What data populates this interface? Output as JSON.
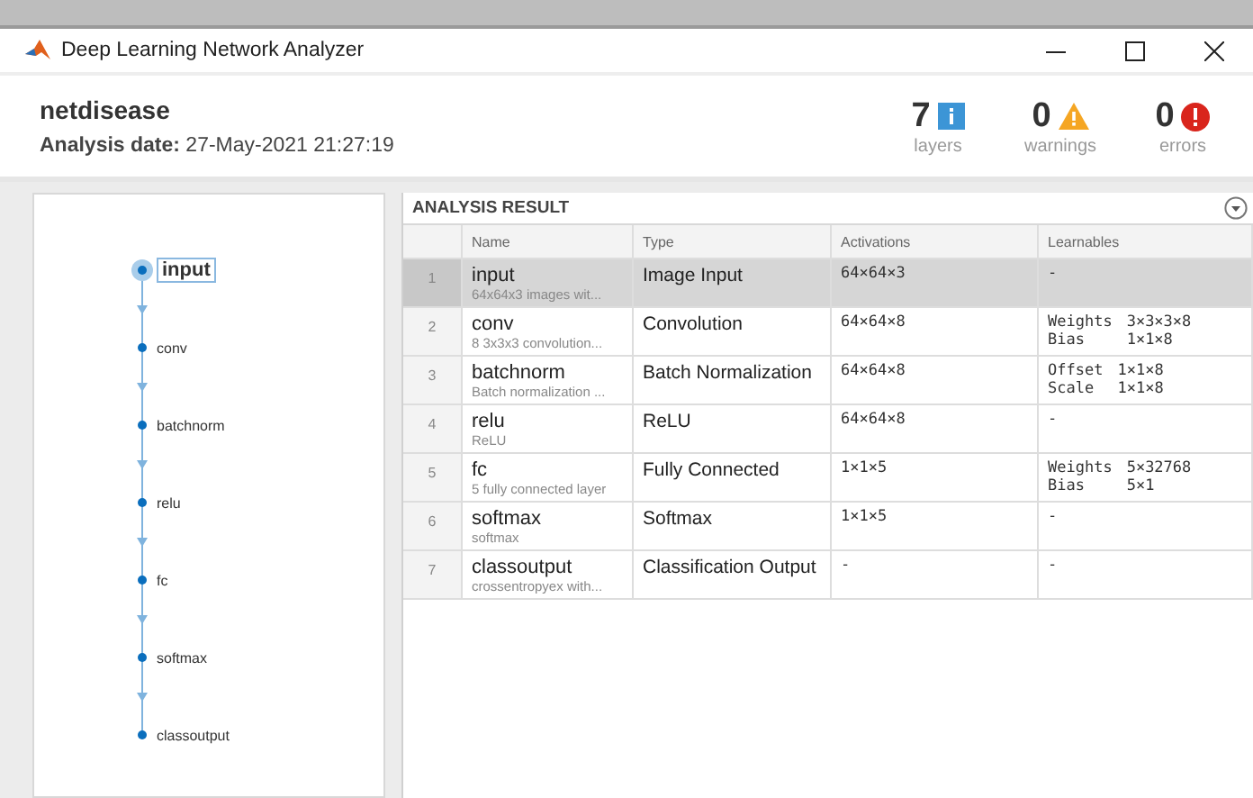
{
  "window": {
    "title": "Deep Learning Network Analyzer"
  },
  "header": {
    "network": "netdisease",
    "date": "**Analysis date:** 27-May-2021 21:27:19"
  },
  "summary": [
    {
      "kind": "info",
      "count": "7",
      "label": "layers"
    },
    {
      "kind": "warning",
      "count": "0",
      "label": "warnings"
    },
    {
      "kind": "error",
      "count": "0",
      "label": "errors"
    }
  ],
  "graph": {
    "nodes": [
      {
        "label": "input",
        "selected": true
      },
      {
        "label": "conv",
        "selected": false
      },
      {
        "label": "batchnorm",
        "selected": false
      },
      {
        "label": "relu",
        "selected": false
      },
      {
        "label": "fc",
        "selected": false
      },
      {
        "label": "softmax",
        "selected": false
      },
      {
        "label": "classoutput",
        "selected": false
      }
    ]
  },
  "table": {
    "title": "ANALYSIS RESULT",
    "columns": [
      "Name",
      "Type",
      "Activations",
      "Learnables"
    ],
    "rows": [
      {
        "index": "1",
        "name": "input",
        "description": "64x64x3 images wit...",
        "type": "Image Input",
        "activations": "64×64×3",
        "learnables_text": "-",
        "selected": true
      },
      {
        "index": "2",
        "name": "conv",
        "description": "8 3x3x3 convolution...",
        "type": "Convolution",
        "activations": "64×64×8",
        "learnables": [
          {
            "label": "Weights",
            "value": "3×3×3×8"
          },
          {
            "label": "Bias",
            "value": "1×1×8"
          }
        ],
        "selected": false
      },
      {
        "index": "3",
        "name": "batchnorm",
        "description": "Batch normalization ...",
        "type": "Batch Normalization",
        "activations": "64×64×8",
        "learnables": [
          {
            "label": "Offset",
            "value": "1×1×8"
          },
          {
            "label": "Scale",
            "value": "1×1×8"
          }
        ],
        "selected": false
      },
      {
        "index": "4",
        "name": "relu",
        "description": "ReLU",
        "type": "ReLU",
        "activations": "64×64×8",
        "learnables_text": "-",
        "selected": false
      },
      {
        "index": "5",
        "name": "fc",
        "description": "5 fully connected layer",
        "type": "Fully Connected",
        "activations": "1×1×5",
        "learnables": [
          {
            "label": "Weights",
            "value": "5×32768"
          },
          {
            "label": "Bias",
            "value": "5×1"
          }
        ],
        "selected": false
      },
      {
        "index": "6",
        "name": "softmax",
        "description": "softmax",
        "type": "Softmax",
        "activations": "1×1×5",
        "learnables_text": "-",
        "selected": false
      },
      {
        "index": "7",
        "name": "classoutput",
        "description": "crossentropyex with...",
        "type": "Classification Output",
        "activations": "-",
        "learnables_text": "-",
        "selected": false
      }
    ]
  }
}
